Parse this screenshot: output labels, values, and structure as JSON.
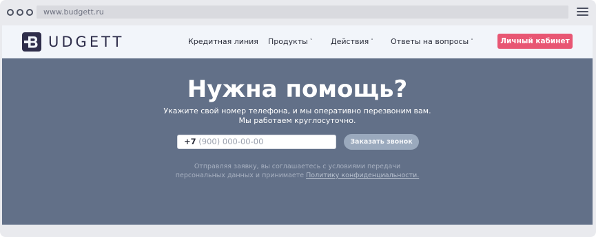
{
  "browser": {
    "url": "www.budgett.ru",
    "window_dots": [
      "dot-1",
      "dot-2",
      "dot-3"
    ],
    "menu_icon": "hamburger-menu-icon"
  },
  "header": {
    "logo_text": "UDGETT",
    "logo_icon": "budgett-b-logo-icon",
    "nav": [
      {
        "label": "Кредитная линия",
        "has_dropdown": false
      },
      {
        "label": "Продукты",
        "has_dropdown": true
      },
      {
        "label": "Действия",
        "has_dropdown": true
      },
      {
        "label": "Ответы на вопросы",
        "has_dropdown": true
      }
    ],
    "chevron": "˅",
    "cabinet_button": "Личный кабинет"
  },
  "hero": {
    "title": "Нужна помощь?",
    "subtitle_line1": "Укажите свой номер телефона, и мы оперативно перезвоним вам.",
    "subtitle_line2": "Мы работаем круглосуточно.",
    "phone_prefix": "+7",
    "phone_placeholder": "(900) 000-00-00",
    "call_button": "Заказать звонок",
    "consent_line1": "Отправляя заявку, вы соглашаетесь с условиями передачи",
    "consent_line2_prefix": "персональных данных и принимаете",
    "consent_link": "Политику конфиденциальности."
  },
  "colors": {
    "hero_bg": "#627088",
    "header_bg": "#f2f5fa",
    "accent": "#e85673",
    "call_button_bg": "#9aa9bd",
    "logo": "#2f2e4b"
  }
}
